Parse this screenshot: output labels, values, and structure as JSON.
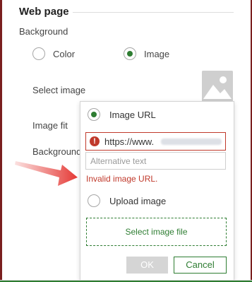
{
  "section": {
    "title": "Web page"
  },
  "background": {
    "label": "Background",
    "options": [
      {
        "label": "Color",
        "selected": false
      },
      {
        "label": "Image",
        "selected": true
      }
    ]
  },
  "fields": {
    "select_image": "Select image",
    "image_fit": "Image fit",
    "background2": "Background"
  },
  "popup": {
    "options": [
      {
        "label": "Image URL",
        "selected": true
      },
      {
        "label": "Upload image",
        "selected": false
      }
    ],
    "url_value": "https://www.",
    "alt_placeholder": "Alternative text",
    "error_message": "Invalid image URL.",
    "select_file_label": "Select image file",
    "ok_label": "OK",
    "cancel_label": "Cancel"
  },
  "colors": {
    "accent": "#2e7d32",
    "error": "#c0392b",
    "arrow": "#e53935"
  },
  "icons": {
    "image_placeholder": "image-icon",
    "error": "error-icon",
    "annotation": "arrow-icon"
  }
}
